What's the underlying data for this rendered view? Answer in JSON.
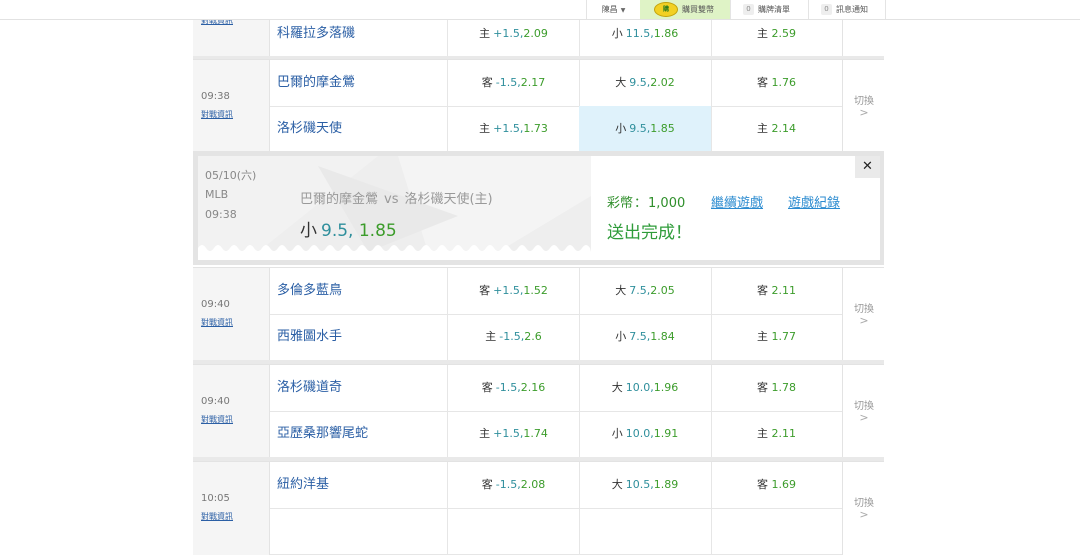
{
  "topbar": {
    "user": "陳昌",
    "buy_coin_icon_text": "購",
    "buy": "購買雙幣",
    "cart_count": "0",
    "cart": "購牌清單",
    "msg_count": "0",
    "msg": "訊息通知"
  },
  "games": [
    {
      "time": "",
      "info_label": "對戰資訊",
      "switch_label": "",
      "rows": [
        {
          "team": "科羅拉多落磯",
          "spread": {
            "prefix": "主",
            "handicap": "+1.5,",
            "odds": "2.09"
          },
          "total": {
            "prefix": "小",
            "handicap": "11.5,",
            "odds": "1.86"
          },
          "ml": {
            "prefix": "主",
            "odds": "2.59"
          }
        }
      ]
    },
    {
      "time": "09:38",
      "info_label": "對戰資訊",
      "switch_label": "切換",
      "rows": [
        {
          "team": "巴爾的摩金鶯",
          "spread": {
            "prefix": "客",
            "handicap": "-1.5,",
            "odds": "2.17"
          },
          "total": {
            "prefix": "大",
            "handicap": "9.5,",
            "odds": "2.02"
          },
          "ml": {
            "prefix": "客",
            "odds": "1.76"
          }
        },
        {
          "team": "洛杉磯天使",
          "spread": {
            "prefix": "主",
            "handicap": "+1.5,",
            "odds": "1.73"
          },
          "total": {
            "prefix": "小",
            "handicap": "9.5,",
            "odds": "1.85"
          },
          "ml": {
            "prefix": "主",
            "odds": "2.14"
          }
        }
      ]
    },
    {
      "time": "09:40",
      "info_label": "對戰資訊",
      "switch_label": "切換",
      "rows": [
        {
          "team": "多倫多藍鳥",
          "spread": {
            "prefix": "客",
            "handicap": "+1.5,",
            "odds": "1.52"
          },
          "total": {
            "prefix": "大",
            "handicap": "7.5,",
            "odds": "2.05"
          },
          "ml": {
            "prefix": "客",
            "odds": "2.11"
          }
        },
        {
          "team": "西雅圖水手",
          "spread": {
            "prefix": "主",
            "handicap": "-1.5,",
            "odds": "2.6"
          },
          "total": {
            "prefix": "小",
            "handicap": "7.5,",
            "odds": "1.84"
          },
          "ml": {
            "prefix": "主",
            "odds": "1.77"
          }
        }
      ]
    },
    {
      "time": "09:40",
      "info_label": "對戰資訊",
      "switch_label": "切換",
      "rows": [
        {
          "team": "洛杉磯道奇",
          "spread": {
            "prefix": "客",
            "handicap": "-1.5,",
            "odds": "2.16"
          },
          "total": {
            "prefix": "大",
            "handicap": "10.0,",
            "odds": "1.96"
          },
          "ml": {
            "prefix": "客",
            "odds": "1.78"
          }
        },
        {
          "team": "亞歷桑那響尾蛇",
          "spread": {
            "prefix": "主",
            "handicap": "+1.5,",
            "odds": "1.74"
          },
          "total": {
            "prefix": "小",
            "handicap": "10.0,",
            "odds": "1.91"
          },
          "ml": {
            "prefix": "主",
            "odds": "2.11"
          }
        }
      ]
    },
    {
      "time": "10:05",
      "info_label": "對戰資訊",
      "switch_label": "切換",
      "rows": [
        {
          "team": "紐約洋基",
          "spread": {
            "prefix": "客",
            "handicap": "-1.5,",
            "odds": "2.08"
          },
          "total": {
            "prefix": "大",
            "handicap": "10.5,",
            "odds": "1.89"
          },
          "ml": {
            "prefix": "客",
            "odds": "1.69"
          }
        },
        {
          "team": "",
          "spread": {
            "prefix": "",
            "handicap": "",
            "odds": ""
          },
          "total": {
            "prefix": "",
            "handicap": "",
            "odds": ""
          },
          "ml": {
            "prefix": "",
            "odds": ""
          }
        }
      ]
    }
  ],
  "confirm": {
    "date": "05/10(六)",
    "league": "MLB",
    "time": "09:38",
    "away": "巴爾的摩金鶯",
    "vs": "vs",
    "home": "洛杉磯天使(主)",
    "bet_type": "小",
    "bet_handicap": "9.5,",
    "bet_odds": "1.85",
    "credit_label": "彩幣",
    "credit_sep": "：",
    "credit_value": "1,000",
    "status": "送出完成！",
    "continue_link": "繼續遊戲",
    "history_link": "遊戲紀錄",
    "close_symbol": "✕"
  },
  "colors": {
    "team_link": "#2b5fa5",
    "odds_green": "#3c9c2b",
    "handicap_teal": "#2f8f9c",
    "selected_bg": "#dff2fb",
    "link_blue": "#2b8bd0"
  }
}
